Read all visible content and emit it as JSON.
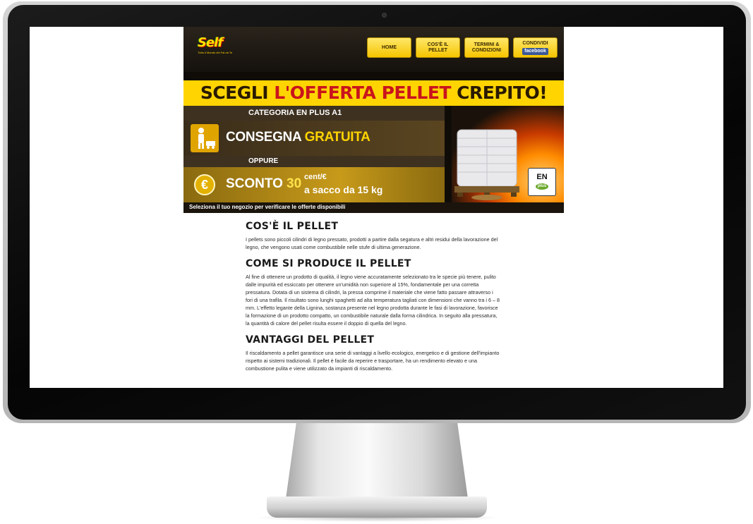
{
  "colors": {
    "accent_yellow": "#ffd400",
    "headline_red": "#c9141c",
    "facebook_blue": "#3b5998"
  },
  "site": {
    "logo": {
      "name": "Self",
      "tagline": "Tutto il Mondo del Fai da Te"
    },
    "nav": [
      {
        "label": "HOME",
        "active": true
      },
      {
        "label": "COS'È IL PELLET",
        "active": false
      },
      {
        "label": "TERMINI & CONDIZIONI",
        "active": false
      },
      {
        "label": "CONDIVIDI",
        "active": false,
        "badge": "facebook"
      }
    ],
    "banner": {
      "headline_part1": "SCEGLI ",
      "headline_highlight": "L'OFFERTA PELLET",
      "headline_part2": " CREPITO!",
      "category": "CATEGORIA EN PLUS A1",
      "consegna_label": "CONSEGNA ",
      "consegna_highlight": "GRATUITA",
      "oppure": "OPPURE",
      "sconto_label": "SCONTO",
      "sconto_value": "30",
      "sconto_unit": "cent/€",
      "sconto_bag": "a sacco da 15 kg",
      "euro_symbol": "€",
      "enplus_label": "EN",
      "enplus_sub": "plus",
      "select_store": "Seleziona il tuo negozio per verificare le offerte disponibili"
    },
    "sections": [
      {
        "title": "COS'È IL PELLET",
        "body": "I pellets sono piccoli cilindri di legno pressato, prodotti a partire dalla segatura e altri residui della lavorazione del legno, che vengono usati come combustibile nelle stufe di ultima generazione."
      },
      {
        "title": "COME SI PRODUCE IL PELLET",
        "body": "Al fine di ottenere un prodotto di qualità, il legno viene accuratamente selezionato tra le specie più tenere, pulito dalle impurità ed essiccato per ottenere un'umidità non superiore al 15%, fondamentale per una corretta pressatura. Dotata di un sistema di cilindri, la pressa comprime il materiale che viene fatto passare attraverso i fori di una trafila. Il risultato sono lunghi spaghetti ad alta temperatura tagliati con dimensioni che vanno tra i 6 – 8 mm. L'effetto legante della Lignina, sostanza presente nel legno prodotta durante le fasi di lavorazione, favorisce la formazione di un prodotto compatto, un combustibile naturale dalla forma cilindrica. In seguito alla pressatura, la quantità di calore del pellet risulta essere il doppio di quella del legno."
      },
      {
        "title": "VANTAGGI DEL PELLET",
        "body": "Il riscaldamento a pellet garantisce una serie di vantaggi a livello ecologico, energetico e di gestione dell'impianto rispetto ai sistemi tradizionali. Il pellet è facile da reperire e trasportare, ha un rendimento elevato e una combustione pulita e viene utilizzato da impianti di riscaldamento."
      }
    ]
  }
}
